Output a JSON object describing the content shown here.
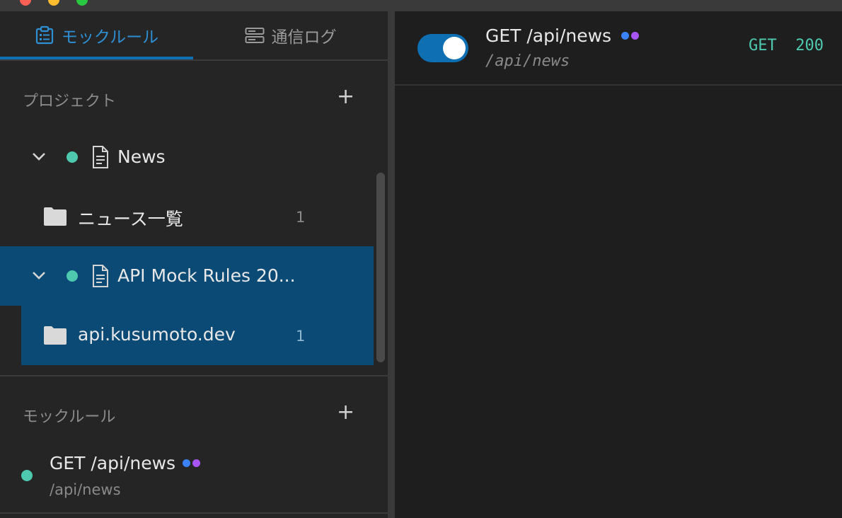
{
  "tabs": {
    "mock_rules": "モックルール",
    "traffic_log": "通信ログ"
  },
  "projects": {
    "title": "プロジェクト",
    "add_label": "+",
    "items": [
      {
        "label": "News",
        "type": "project",
        "expanded": true,
        "status_color": "#4ec9b0"
      },
      {
        "label": "ニュース一覧",
        "type": "folder",
        "count": "1"
      },
      {
        "label": "API Mock Rules 20...",
        "type": "project",
        "expanded": true,
        "status_color": "#4ec9b0",
        "selected": true
      },
      {
        "label": "api.kusumoto.dev",
        "type": "folder",
        "count": "1",
        "selected": true
      }
    ]
  },
  "mock_rules": {
    "title": "モックルール",
    "add_label": "+",
    "items": [
      {
        "title": "GET /api/news",
        "path": "/api/news",
        "tags": [
          "#3b82f6",
          "#a855f7"
        ]
      }
    ]
  },
  "detail": {
    "enabled": true,
    "title": "GET /api/news",
    "path": "/api/news",
    "method": "GET",
    "status_code": "200"
  }
}
